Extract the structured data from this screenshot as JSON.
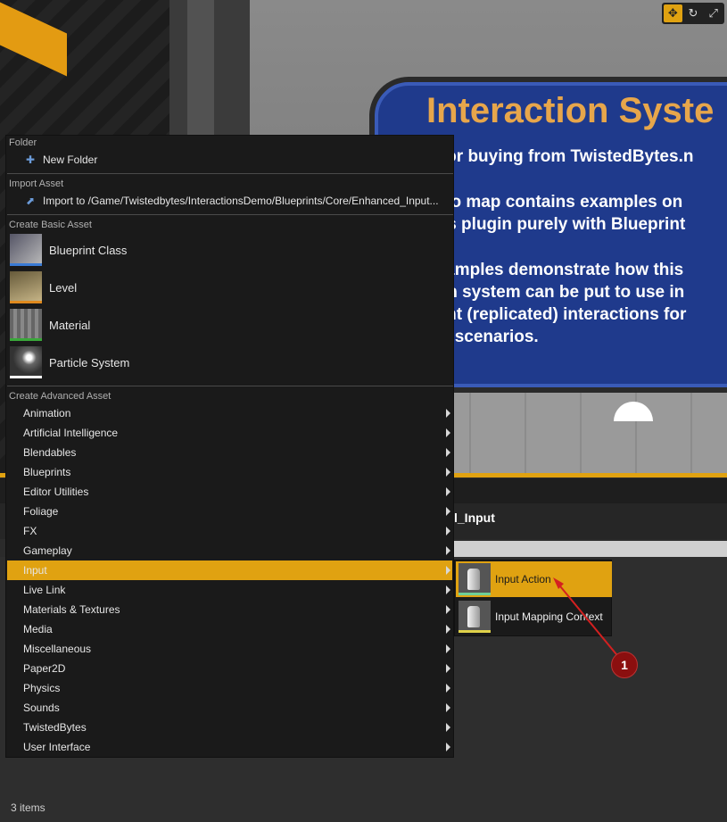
{
  "viewport": {
    "toolbar": [
      "move-icon",
      "rotate-icon",
      "scale-icon"
    ],
    "sign": {
      "title": "Interaction Syste",
      "lines": [
        "s for buying from TwistedBytes.n",
        "emo map contains examples on",
        "this plugin purely with Blueprint",
        "examples demonstrate how this",
        "tion system can be put to use in",
        "hent (replicated) interactions for",
        "lay scenarios."
      ]
    }
  },
  "content_browser": {
    "path_fragment": "l_Input",
    "item_count": "3 items"
  },
  "menu": {
    "folder_header": "Folder",
    "new_folder": "New Folder",
    "import_header": "Import Asset",
    "import_item": "Import to /Game/Twistedbytes/InteractionsDemo/Blueprints/Core/Enhanced_Input...",
    "basic_header": "Create Basic Asset",
    "basic_items": [
      {
        "label": "Blueprint Class",
        "icon": "blueprint-class-icon",
        "color": "#3a7bd5"
      },
      {
        "label": "Level",
        "icon": "level-icon",
        "color": "#e08a1e"
      },
      {
        "label": "Material",
        "icon": "material-icon",
        "color": "#3aa83a"
      },
      {
        "label": "Particle System",
        "icon": "particle-system-icon",
        "color": "#ffffff"
      }
    ],
    "advanced_header": "Create Advanced Asset",
    "advanced_items": [
      "Animation",
      "Artificial Intelligence",
      "Blendables",
      "Blueprints",
      "Editor Utilities",
      "Foliage",
      "FX",
      "Gameplay",
      "Input",
      "Live Link",
      "Materials & Textures",
      "Media",
      "Miscellaneous",
      "Paper2D",
      "Physics",
      "Sounds",
      "TwistedBytes",
      "User Interface"
    ],
    "active_item": "Input",
    "accent": "#e0a211"
  },
  "submenu": {
    "items": [
      {
        "label": "Input Action",
        "color": "#6fcf97"
      },
      {
        "label": "Input Mapping Context",
        "color": "#e0d24a"
      }
    ]
  },
  "annotation": {
    "number": "1"
  }
}
